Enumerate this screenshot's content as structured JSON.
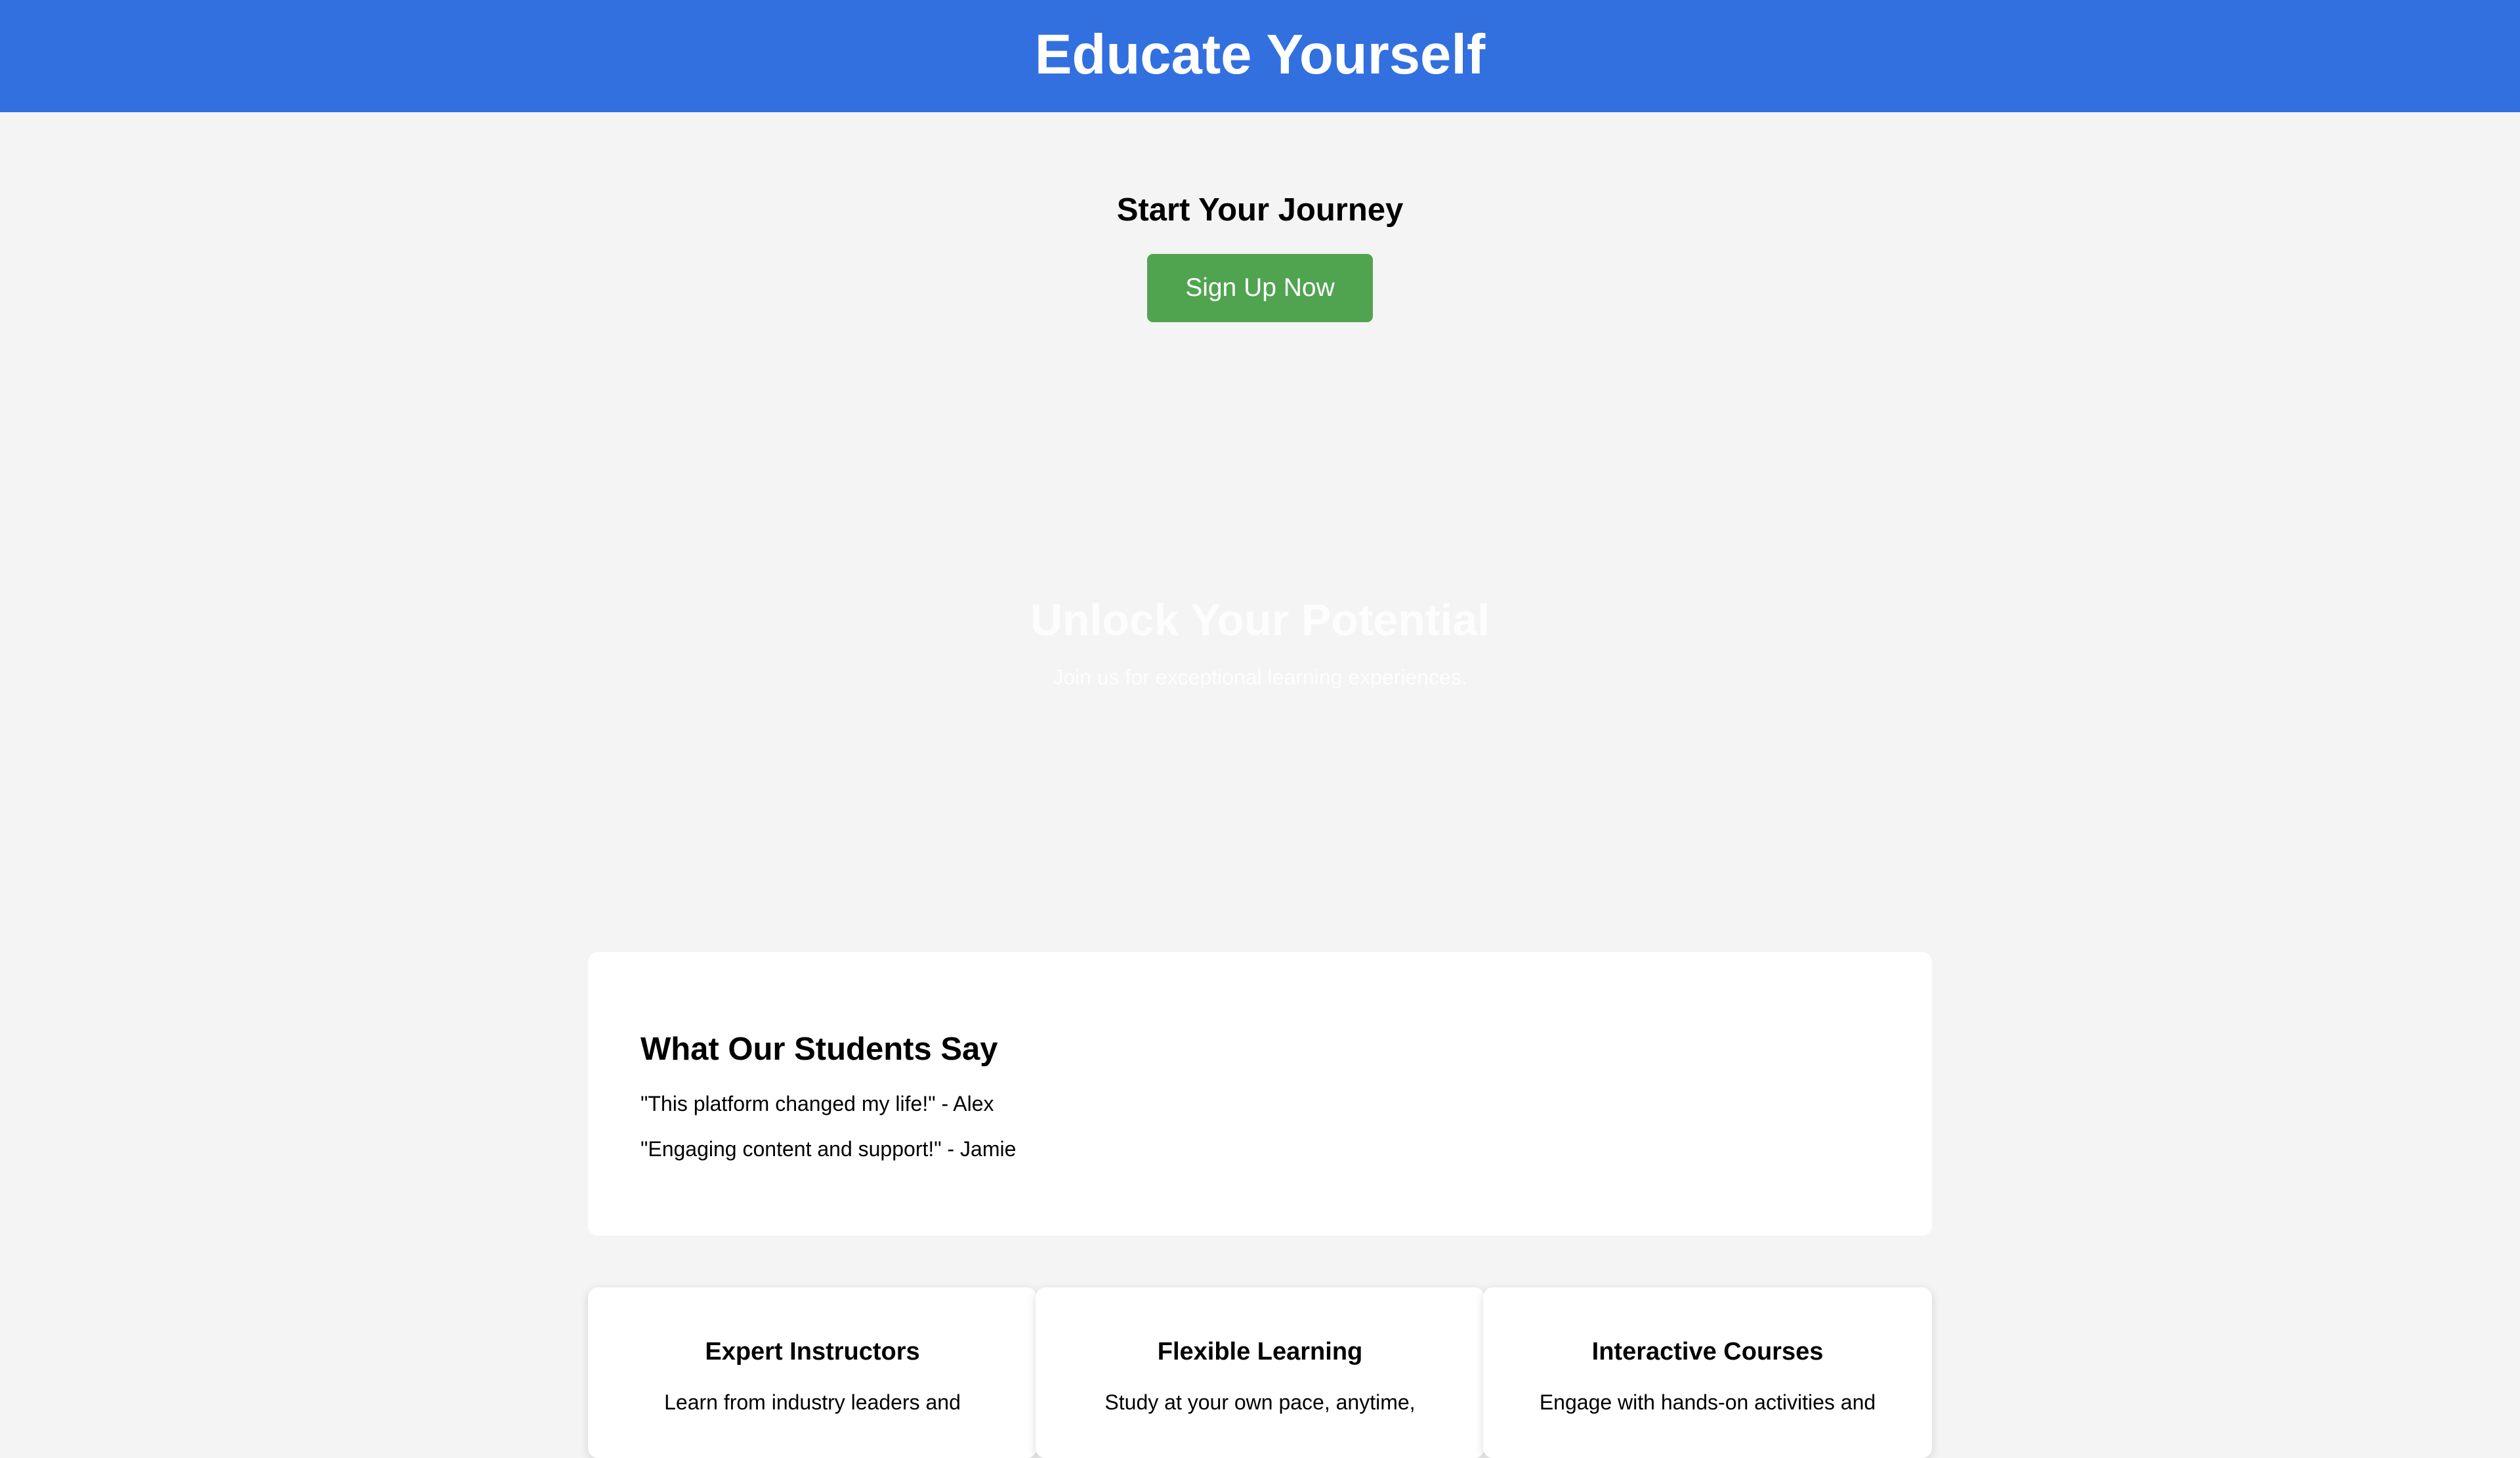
{
  "header": {
    "title": "Educate Yourself",
    "background_color": "#3270e0"
  },
  "journey": {
    "title": "Start Your Journey",
    "signup_label": "Sign Up Now",
    "button_color": "#50a450"
  },
  "hero": {
    "title": "Unlock Your Potential",
    "subtitle": "Join us for exceptional learning experiences."
  },
  "testimonials": {
    "title": "What Our Students Say",
    "quotes": [
      "\"This platform changed my life!\" - Alex",
      "\"Engaging content and support!\" - Jamie"
    ]
  },
  "features": [
    {
      "title": "Expert Instructors",
      "text": "Learn from industry leaders and"
    },
    {
      "title": "Flexible Learning",
      "text": "Study at your own pace, anytime,"
    },
    {
      "title": "Interactive Courses",
      "text": "Engage with hands-on activities and"
    }
  ],
  "colors": {
    "page_background": "#f4f4f4",
    "card_background": "#ffffff",
    "text": "#000000"
  }
}
